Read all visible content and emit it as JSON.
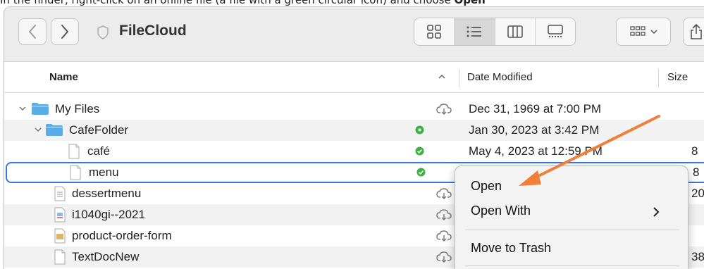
{
  "instruction": {
    "text_before": "In the finder, right-click on an online file (a file with a green circular icon) and choose ",
    "text_bold": "Open"
  },
  "window": {
    "title": "FileCloud"
  },
  "columns": {
    "name": "Name",
    "date_modified": "Date Modified",
    "size": "Size"
  },
  "rows": [
    {
      "name": "My Files",
      "date": "Dec 31, 1969 at 7:00 PM",
      "size": "",
      "kind": "folder",
      "status": "cloud"
    },
    {
      "name": "CafeFolder",
      "date": "Jan 30, 2023 at 3:42 PM",
      "size": "",
      "kind": "folder",
      "status": "syncing"
    },
    {
      "name": "café",
      "date": "May 4, 2023 at 12:59 PM",
      "size": "8",
      "kind": "file",
      "status": "synced"
    },
    {
      "name": "menu",
      "date": "",
      "size": "8",
      "kind": "file",
      "status": "synced"
    },
    {
      "name": "dessertmenu",
      "date": "",
      "size": "20",
      "kind": "doc",
      "status": "cloud"
    },
    {
      "name": "i1040gi--2021",
      "date": "",
      "size": "",
      "kind": "pdf",
      "status": "cloud"
    },
    {
      "name": "product-order-form",
      "date": "",
      "size": "",
      "kind": "form",
      "status": "cloud"
    },
    {
      "name": "TextDocNew",
      "date": "",
      "size": "38",
      "kind": "file",
      "status": "cloud"
    }
  ],
  "context_menu": {
    "open": "Open",
    "open_with": "Open With",
    "move_to_trash": "Move to Trash"
  },
  "colors": {
    "accent_blue": "#3a78d8",
    "folder_blue": "#5aaee8",
    "status_green": "#3cb043",
    "arrow_orange": "#f07f3c"
  }
}
